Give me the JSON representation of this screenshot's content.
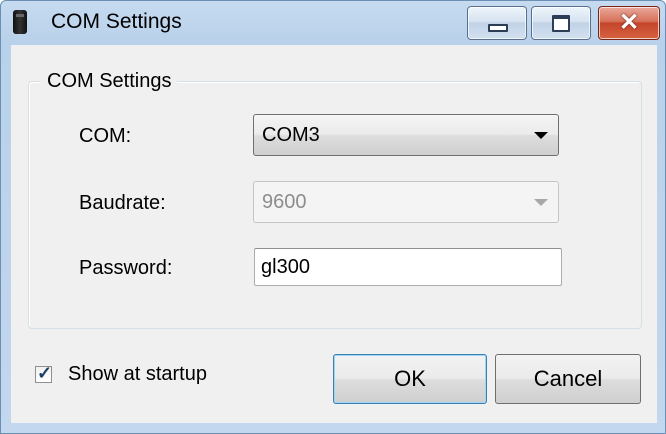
{
  "window": {
    "title": "COM Settings",
    "controls": {
      "minimize_icon": "minimize-icon",
      "maximize_icon": "maximize-icon",
      "close_icon": "close-icon",
      "close_glyph": "✕"
    }
  },
  "group": {
    "title": "COM Settings",
    "com": {
      "label": "COM:",
      "value": "COM3"
    },
    "baudrate": {
      "label": "Baudrate:",
      "value": "9600",
      "enabled": false
    },
    "password": {
      "label": "Password:",
      "value": "gl300"
    }
  },
  "startup_checkbox": {
    "label": "Show at startup",
    "checked": true,
    "check_glyph": "✓"
  },
  "buttons": {
    "ok": "OK",
    "cancel": "Cancel"
  },
  "colors": {
    "titlebar": "#b9d1ea",
    "close_button": "#c4452c",
    "dialog_background": "#f0f0f0",
    "default_button_border": "#3c7fb1"
  }
}
